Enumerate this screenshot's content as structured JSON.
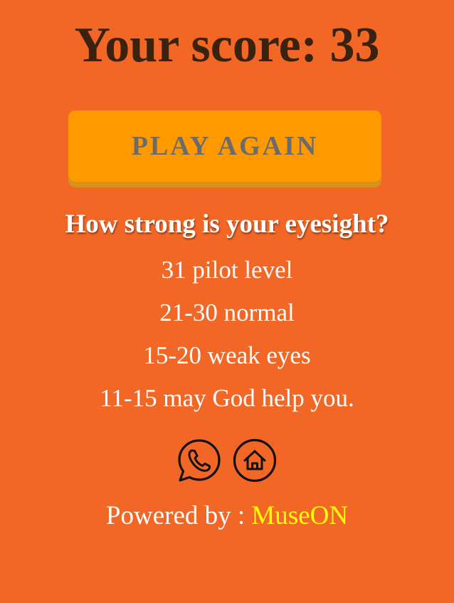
{
  "score": {
    "label": "Your score: 33"
  },
  "actions": {
    "play_again_label": "PLAY AGAIN"
  },
  "eyesight": {
    "heading": "How strong is your eyesight?",
    "levels": [
      "31 pilot level",
      "21-30 normal",
      "15-20 weak eyes",
      "11-15 may God help you."
    ]
  },
  "share": {
    "icons": [
      "whatsapp-icon",
      "home-icon"
    ]
  },
  "footer": {
    "powered_prefix": "Powered by : ",
    "brand": "MuseON"
  },
  "colors": {
    "background": "#f26726",
    "button": "#ff9900",
    "brand": "#ffff00",
    "score_text": "#3a220f"
  }
}
